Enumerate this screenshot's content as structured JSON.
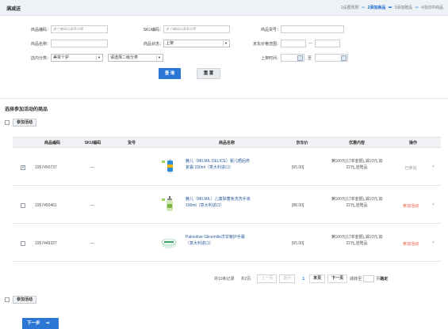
{
  "header": {
    "title": "满减送",
    "steps": [
      {
        "label": "1设置规则",
        "current": false
      },
      {
        "label": "2添加商品",
        "current": true
      },
      {
        "label": "3添加赠品",
        "current": false
      },
      {
        "label": "4活动中商品",
        "current": false
      }
    ]
  },
  "filters": {
    "product_code_label": "商品编码：",
    "product_code_placeholder": "多个编码以逗号分隔",
    "sku_code_label": "SKU编码：",
    "sku_code_placeholder": "多个编码以逗号分隔",
    "item_no_label": "商品货号：",
    "product_name_label": "商品名称：",
    "status_label": "商品状态：",
    "status_value": "上架",
    "price_range_label": "京东价格范围：",
    "price_range_sep": "—",
    "category_label": "店内分类：",
    "category1_value": "美妆个护",
    "category2_value": "请选择二级分类",
    "listing_time_label": "上架时间：",
    "listing_time_sep": "至",
    "search_button": "查 询",
    "reset_button": "重 置"
  },
  "section": {
    "title": "选择参加活动的商品",
    "join_button": "参加活动"
  },
  "table": {
    "headers": [
      "商品编码",
      "SKU编码",
      "货号",
      "商品名称",
      "京东价",
      "优惠内容",
      "操作"
    ],
    "rows": [
      {
        "checked": true,
        "code": "1957450737",
        "sku": "—",
        "item_no": "",
        "name_line1": "魅儿（MILMIL DELICE）婴儿晒后修",
        "name_line2": "复霜 100ml（意大利进口）",
        "price": "[65.00]",
        "promo_line1": "满100元(订单金额),减10元,如",
        "promo_line2": "22元,送赠品",
        "op": "已参加",
        "op_state": "joined",
        "thumb": "blue-tube"
      },
      {
        "checked": false,
        "code": "1957450461",
        "sku": "—",
        "item_no": "",
        "name_line1": "魅儿（MILMIL）儿童除菌免洗洗手液",
        "name_line2": "100ml（意大利进口）",
        "price": "[88.00]",
        "promo_line1": "满100元(订单金额),减10元,如",
        "promo_line2": "22元,送赠品",
        "op": "参加活动",
        "op_state": "join",
        "thumb": "green-bottle"
      },
      {
        "checked": false,
        "code": "1957449327",
        "sku": "—",
        "item_no": "",
        "name_line1": "Palmolive Glicemille洋甘菊护手霜",
        "name_line2": "（意大利进口）",
        "price": "[65.00]",
        "promo_line1": "满100元(订单金额),减10元,如",
        "promo_line2": "22元,送赠品",
        "op": "参加活动",
        "op_state": "join",
        "thumb": "cream-jar"
      }
    ]
  },
  "pager": {
    "total_records": "共10条记录",
    "total_pages": "共2页",
    "first": "上一页",
    "prev": "首页",
    "current": "1",
    "last": "末页",
    "next": "下一页",
    "goto_label": "跳转至",
    "page_suffix": "页",
    "confirm": "确定"
  },
  "footer": {
    "join_button": "参加活动",
    "next_button": "下一步"
  },
  "colors": {
    "accent": "#2c77d6",
    "join_link": "#e4563b",
    "header_bg": "#eef2f7"
  }
}
